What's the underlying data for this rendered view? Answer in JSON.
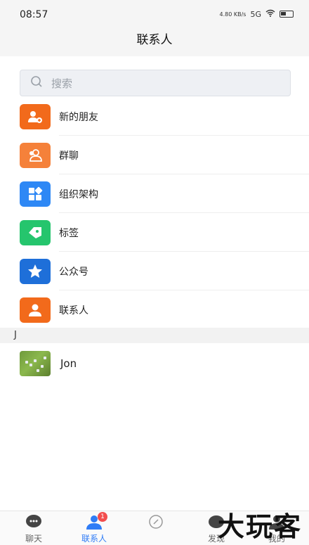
{
  "status_bar": {
    "time": "08:57",
    "net_speed": "4.80 KB/s",
    "signal_label": "5G"
  },
  "header": {
    "title": "联系人"
  },
  "search": {
    "placeholder": "搜索"
  },
  "menu": [
    {
      "label": "新的朋友",
      "icon": "add-person-icon",
      "color": "#f26a1b"
    },
    {
      "label": "群聊",
      "icon": "group-icon",
      "color": "#f5813a"
    },
    {
      "label": "组织架构",
      "icon": "org-blocks-icon",
      "color": "#2e88f5"
    },
    {
      "label": "标签",
      "icon": "tag-icon",
      "color": "#25c56d"
    },
    {
      "label": "公众号",
      "icon": "star-icon",
      "color": "#1e6fd9"
    },
    {
      "label": "联系人",
      "icon": "person-icon",
      "color": "#f26a1b"
    }
  ],
  "sections": [
    {
      "letter": "J",
      "contacts": [
        {
          "name": "Jon"
        }
      ]
    }
  ],
  "tabs": [
    {
      "label": "聊天",
      "icon": "chat-bubble-icon",
      "active": false
    },
    {
      "label": "联系人",
      "icon": "contacts-icon",
      "active": true,
      "badge": "1"
    },
    {
      "label": "",
      "icon": "compass-icon",
      "active": false
    },
    {
      "label": "发现",
      "icon": "discover-icon",
      "active": false
    },
    {
      "label": "我的",
      "icon": "profile-icon",
      "active": false
    }
  ],
  "watermark": {
    "text": "大玩客"
  },
  "colors": {
    "accent": "#2f7cf6",
    "badge": "#f24d4d"
  }
}
